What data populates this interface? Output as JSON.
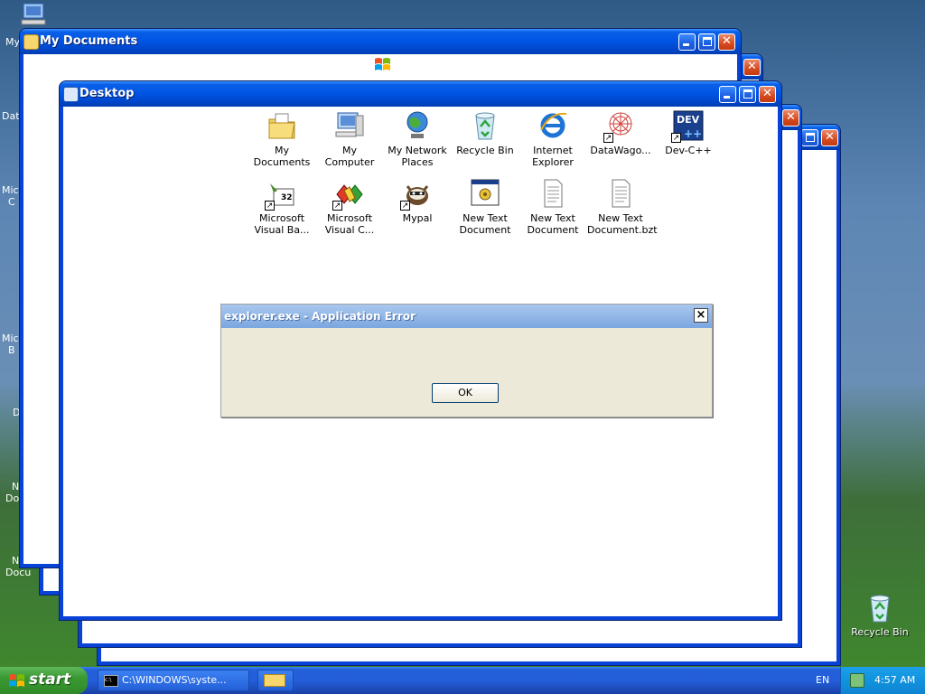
{
  "desktop": {
    "partial_labels": [
      "My",
      "Data",
      "Micro\nC",
      "Micro\nB",
      "D",
      "N\nDoc",
      "N\nDocu"
    ],
    "recycle_bin_label": "Recycle Bin"
  },
  "windows": {
    "my_documents": {
      "title": "My Documents"
    },
    "desktop": {
      "title": "Desktop"
    }
  },
  "desktop_window_icons": [
    {
      "label": "My Documents",
      "icon": "my-documents-icon"
    },
    {
      "label": "My Computer",
      "icon": "my-computer-icon"
    },
    {
      "label": "My Network Places",
      "icon": "my-network-places-icon"
    },
    {
      "label": "Recycle Bin",
      "icon": "recycle-bin-icon"
    },
    {
      "label": "Internet Explorer",
      "icon": "internet-explorer-icon"
    },
    {
      "label": "DataWago...",
      "icon": "datawago-icon"
    },
    {
      "label": "Dev-C++",
      "icon": "dev-cpp-icon"
    },
    {
      "label": "Microsoft Visual Ba...",
      "icon": "visual-basic-icon"
    },
    {
      "label": "Microsoft Visual C...",
      "icon": "visual-c-icon"
    },
    {
      "label": "Mypal",
      "icon": "mypal-icon"
    },
    {
      "label": "New Text Document",
      "icon": "application-icon"
    },
    {
      "label": "New Text Document",
      "icon": "text-document-icon"
    },
    {
      "label": "New Text Document.bzt",
      "icon": "text-document-icon"
    }
  ],
  "dialog": {
    "title": "explorer.exe - Application Error",
    "close_label": "×",
    "ok_label": "OK"
  },
  "taskbar": {
    "start_label": "start",
    "task_cmd_label": "C:\\WINDOWS\\syste...",
    "language": "EN",
    "clock": "4:57 AM"
  },
  "colors": {
    "title_bar": "#0054e3",
    "taskbar": "#245edb",
    "start": "#3a9932",
    "dialog_bg": "#ece9d8"
  }
}
